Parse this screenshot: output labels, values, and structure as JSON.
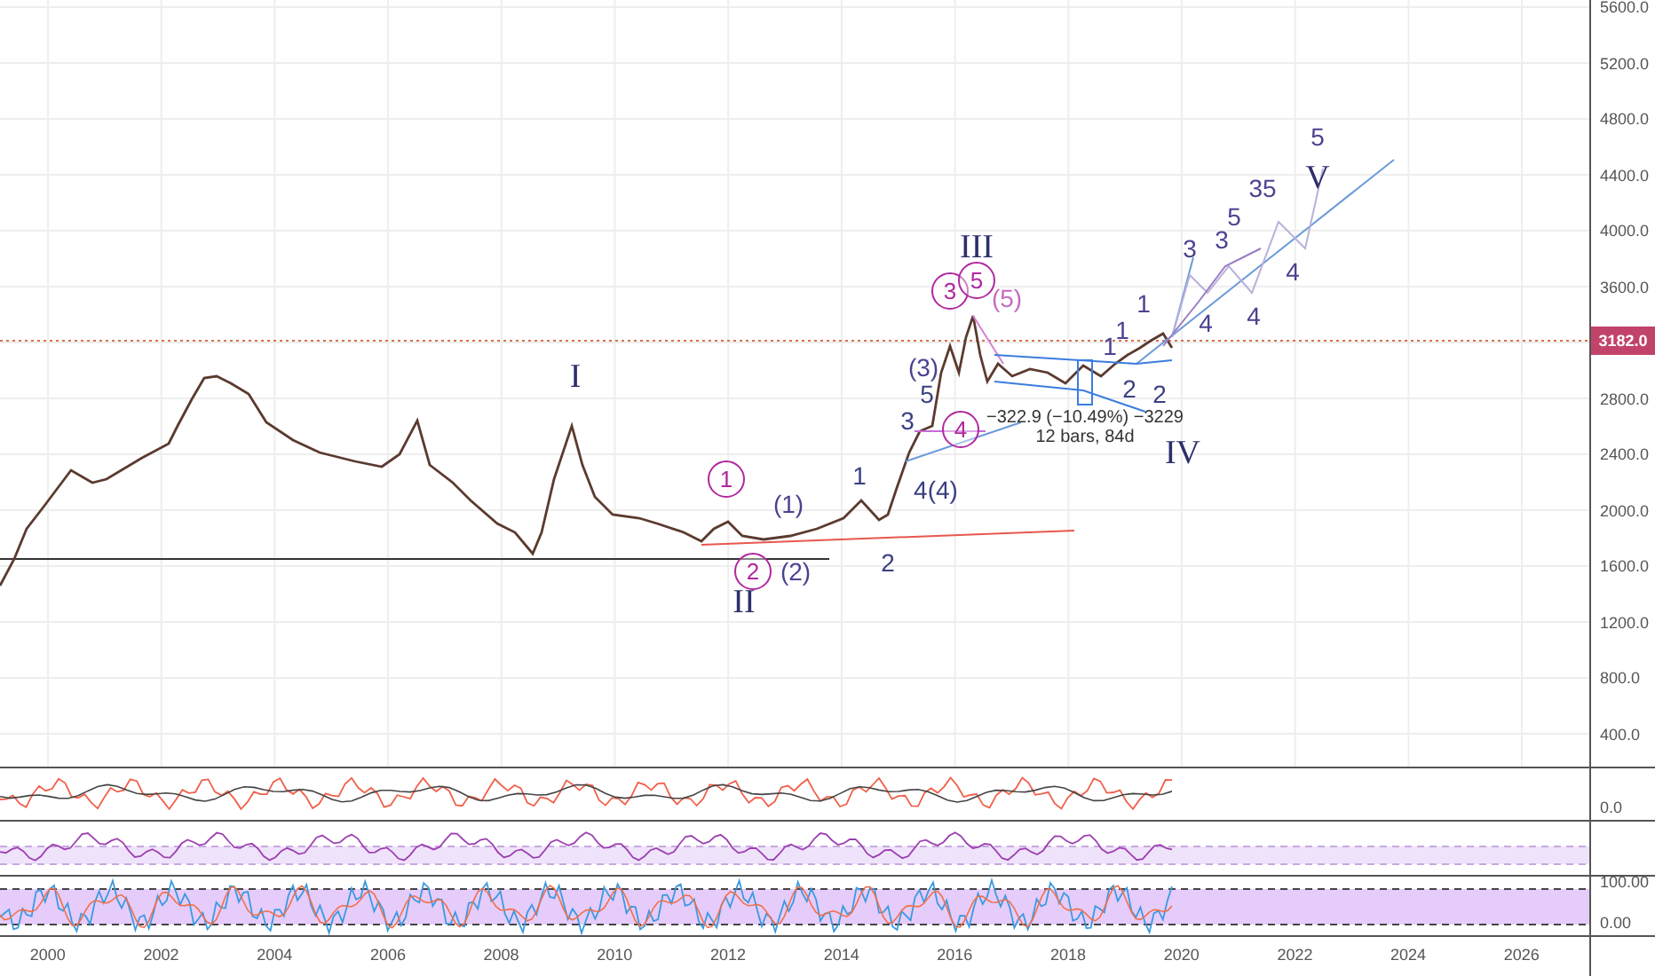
{
  "price_axis": {
    "ticks": [
      "5600.0",
      "5200.0",
      "4800.0",
      "4400.0",
      "4000.0",
      "3600.0",
      "2800.0",
      "2400.0",
      "2000.0",
      "1600.0",
      "1200.0",
      "800.0",
      "400.0"
    ],
    "current_price": "3182.0"
  },
  "wave_labels": [
    {
      "text": "I",
      "kind": "roman",
      "color": "#2d2f6b"
    },
    {
      "text": "II",
      "kind": "roman",
      "color": "#2d2f6b"
    },
    {
      "text": "III",
      "kind": "roman",
      "color": "#2d2f6b"
    },
    {
      "text": "IV",
      "kind": "roman",
      "color": "#2d2f6b"
    },
    {
      "text": "V",
      "kind": "roman",
      "color": "#2d2f6b"
    },
    {
      "text": "1",
      "kind": "circled",
      "color": "#b0289e"
    },
    {
      "text": "2",
      "kind": "circled",
      "color": "#b0289e"
    },
    {
      "text": "(1)",
      "kind": "plain",
      "color": "#4b4390"
    },
    {
      "text": "(2)",
      "kind": "plain",
      "color": "#4b4390"
    },
    {
      "text": "1",
      "kind": "plain",
      "color": "#3a3f82"
    },
    {
      "text": "2",
      "kind": "plain",
      "color": "#3a3f82"
    },
    {
      "text": "3",
      "kind": "plain",
      "color": "#3a3f82"
    },
    {
      "text": "(3)",
      "kind": "plain",
      "color": "#4b4390"
    },
    {
      "text": "5",
      "kind": "plain",
      "color": "#3a3f82"
    },
    {
      "text": "4(4)",
      "kind": "plain",
      "color": "#3a3f82"
    },
    {
      "text": "4",
      "kind": "circled",
      "color": "#b0289e"
    },
    {
      "text": "3",
      "kind": "circled",
      "color": "#b0289e"
    },
    {
      "text": "5",
      "kind": "circled",
      "color": "#b0289e"
    },
    {
      "text": "(5)",
      "kind": "plain",
      "color": "#c46cc0"
    },
    {
      "text": "1",
      "kind": "plain",
      "color": "#4b4390"
    },
    {
      "text": "1",
      "kind": "plain",
      "color": "#4b4390"
    },
    {
      "text": "1",
      "kind": "plain",
      "color": "#4b4390"
    },
    {
      "text": "2",
      "kind": "plain",
      "color": "#3a3f82"
    },
    {
      "text": "2",
      "kind": "plain",
      "color": "#3a3f82"
    },
    {
      "text": "3",
      "kind": "plain",
      "color": "#4b4390"
    },
    {
      "text": "3",
      "kind": "plain",
      "color": "#4b4390"
    },
    {
      "text": "5",
      "kind": "plain",
      "color": "#4b4390"
    },
    {
      "text": "35",
      "kind": "plain",
      "color": "#4b4390"
    },
    {
      "text": "5",
      "kind": "plain",
      "color": "#4b4390"
    },
    {
      "text": "4",
      "kind": "plain",
      "color": "#4b4390"
    },
    {
      "text": "4",
      "kind": "plain",
      "color": "#4b4390"
    },
    {
      "text": "4",
      "kind": "plain",
      "color": "#4b4390"
    }
  ],
  "measure": {
    "change": "−322.9 (−10.49%) −3229",
    "span": "12 bars, 84d"
  },
  "indicator_axes": [
    {
      "label": "0.0"
    },
    {
      "label": "100.00"
    },
    {
      "label": "0.00"
    }
  ],
  "time_axis": [
    "2000",
    "2002",
    "2004",
    "2006",
    "2008",
    "2010",
    "2012",
    "2014",
    "2016",
    "2018",
    "2020",
    "2022",
    "2024",
    "2026"
  ]
}
